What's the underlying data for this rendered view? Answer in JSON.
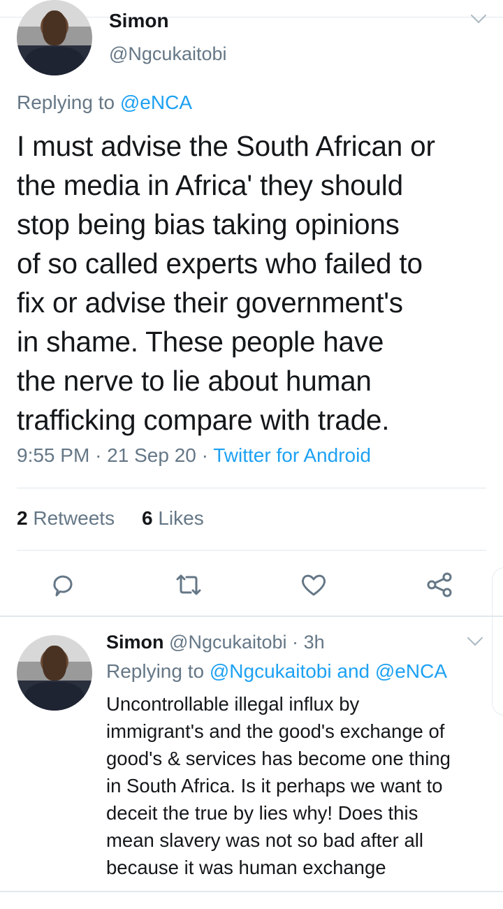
{
  "tweet": {
    "author_name": "Simon",
    "author_handle": "@Ngcukaitobi",
    "replying_prefix": "Replying to ",
    "replying_to": "@eNCA",
    "lines": [
      "I must advise the South African or",
      "the media in Africa' they should",
      "stop being bias taking opinions",
      "of so called experts who failed to",
      "fix or advise their government's",
      "in shame. These people have",
      "the nerve to lie about human",
      "trafficking compare with trade."
    ],
    "time": "9:55 PM",
    "date": "21 Sep 20",
    "dot": "·",
    "source": "Twitter for Android",
    "retweets_count": "2",
    "retweets_label": "Retweets",
    "likes_count": "6",
    "likes_label": "Likes"
  },
  "reply": {
    "author_name": "Simon",
    "author_handle": "@Ngcukaitobi",
    "age": "3h",
    "dot": "·",
    "replying_prefix": "Replying to ",
    "replying_to": "@Ngcukaitobi and @eNCA",
    "lines": [
      "Uncontrollable illegal influx by",
      "immigrant's and the good's exchange of",
      "good's & services has become one thing",
      "in South Africa. Is it perhaps we want to",
      "deceit the true by lies why! Does this",
      "mean slavery was not so bad after all",
      "because it was human exchange"
    ]
  },
  "icons": {
    "reply": "comment-icon",
    "retweet": "retweet-icon",
    "like": "heart-icon",
    "share": "share-icon",
    "menu": "chevron-down-icon"
  },
  "colors": {
    "link": "#1da1f2",
    "secondary_text": "#657786",
    "divider": "#e1e8ed",
    "icon": "#657786"
  }
}
